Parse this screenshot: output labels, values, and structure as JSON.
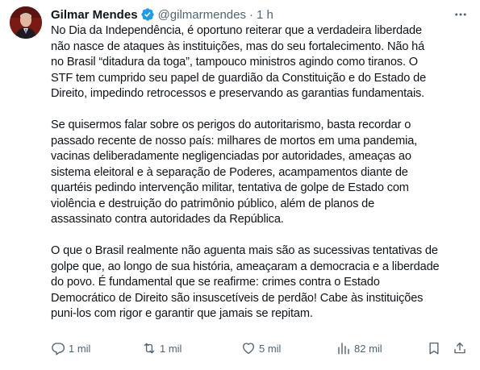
{
  "author": {
    "name": "Gilmar Mendes",
    "handle": "@gilmarmendes",
    "separator": "·",
    "time": "1 h",
    "verified_color": "#1d9bf0"
  },
  "tweet": {
    "paragraphs": [
      [
        "No Dia da Independência, é oportuno reiterar que a verdadeira liberdade",
        "não nasce de ataques às instituições, mas do seu fortalecimento. Não há",
        "no Brasil “ditadura da toga”, tampouco ministros agindo como tiranos. O",
        "STF tem cumprido seu papel de guardião da Constituição e do Estado de",
        "Direito, impedindo retrocessos e preservando as garantias fundamentais."
      ],
      [
        "Se quisermos falar sobre os perigos do autoritarismo, basta recordar o",
        "passado recente de nosso país: milhares de mortos em uma pandemia,",
        "vacinas deliberadamente negligenciadas por autoridades, ameaças ao",
        "sistema eleitoral e à separação de Poderes, acampamentos diante de",
        "quartéis pedindo intervenção militar, tentativa de golpe de Estado com",
        "violência e destruição do patrimônio público, além de planos de",
        "assassinato contra autoridades da República."
      ],
      [
        "O que o Brasil realmente não aguenta mais são as sucessivas tentativas de",
        "golpe que, ao longo de sua história, ameaçaram a democracia e a liberdade",
        "do povo. É fundamental que se reafirme: crimes contra o Estado",
        "Democrático de Direito são insuscetíveis de perdão! Cabe às instituições",
        "puni-los com rigor e garantir que jamais se repitam."
      ]
    ]
  },
  "actions": {
    "replies": "1 mil",
    "reposts": "1 mil",
    "likes": "5 mil",
    "views": "82 mil",
    "icons": [
      "reply-icon",
      "repost-icon",
      "like-icon",
      "views-icon",
      "bookmark-icon",
      "share-icon"
    ]
  },
  "colors": {
    "text": "#0f1419",
    "secondary": "#536471",
    "verified": "#1d9bf0"
  }
}
